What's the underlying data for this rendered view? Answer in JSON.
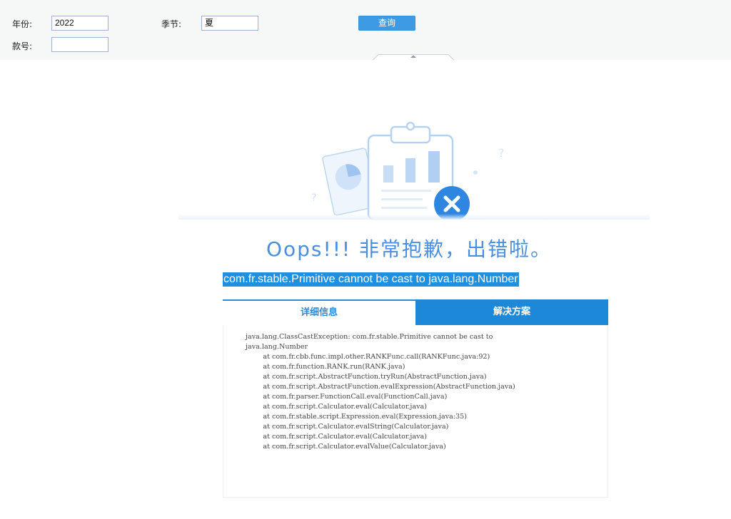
{
  "filters": {
    "year_label": "年份:",
    "year_value": "2022",
    "season_label": "季节:",
    "season_value": "夏",
    "style_no_label": "款号:",
    "style_no_value": ""
  },
  "query_button": "查询",
  "error": {
    "title": "Oops!!! 非常抱歉，出错啦。",
    "message": "com.fr.stable.Primitive cannot be cast to java.lang.Number"
  },
  "tabs": {
    "detail": "详细信息",
    "solution": "解决方案"
  },
  "stack_trace": [
    "java.lang.ClassCastException: com.fr.stable.Primitive cannot be cast to",
    "java.lang.Number",
    "        at com.fr.cbb.func.impl.other.RANKFunc.call(RANKFunc.java:92)",
    "        at com.fr.function.RANK.run(RANK.java)",
    "        at com.fr.script.AbstractFunction.tryRun(AbstractFunction.java)",
    "        at com.fr.script.AbstractFunction.evalExpression(AbstractFunction.java)",
    "        at com.fr.parser.FunctionCall.eval(FunctionCall.java)",
    "        at com.fr.script.Calculator.eval(Calculator.java)",
    "        at com.fr.stable.script.Expression.eval(Expression.java:35)",
    "        at com.fr.script.Calculator.evalString(Calculator.java)",
    "        at com.fr.script.Calculator.eval(Calculator.java)",
    "        at com.fr.script.Calculator.evalValue(Calculator.java)"
  ],
  "colors": {
    "accent": "#1e88d8",
    "title": "#4a8fdf",
    "error_icon": "#2f86e0"
  },
  "icons": {
    "illustration": "clipboard-chart-error-illustration",
    "collapse": "chevron-up-icon"
  }
}
